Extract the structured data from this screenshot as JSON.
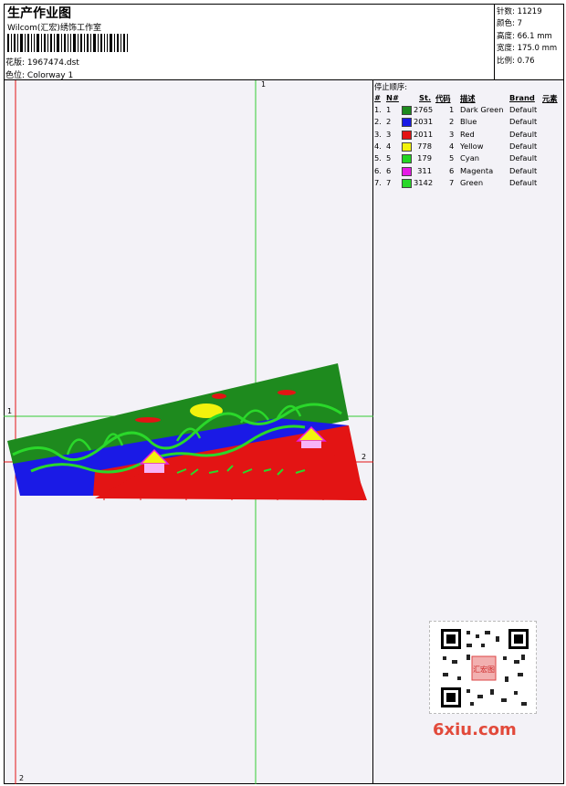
{
  "header": {
    "title": "生产作业图",
    "company": "Wilcom(汇宏)绣饰工作室",
    "design_label": "花版:",
    "design_value": "1967474.dst",
    "colorway_label": "色位:",
    "colorway_value": "Colorway 1"
  },
  "stats": {
    "stitches_label": "针数:",
    "stitches_value": "11219",
    "colors_label": "颜色:",
    "colors_value": "7",
    "height_label": "高度:",
    "height_value": "66.1 mm",
    "width_label": "宽度:",
    "width_value": "175.0 mm",
    "scale_label": "比例:",
    "scale_value": "0.76"
  },
  "stop_sequence": {
    "title": "停止顺序:",
    "columns": [
      "#",
      "N#",
      "St.",
      "代码",
      "描述",
      "Brand",
      "元素"
    ],
    "rows": [
      {
        "idx": "1.",
        "n": "1",
        "color": "#1e8a1e",
        "st": "2765",
        "code": "1",
        "desc": "Dark Green",
        "brand": "Default"
      },
      {
        "idx": "2.",
        "n": "2",
        "color": "#1a1ae6",
        "st": "2031",
        "code": "2",
        "desc": "Blue",
        "brand": "Default"
      },
      {
        "idx": "3.",
        "n": "3",
        "color": "#e31414",
        "st": "2011",
        "code": "3",
        "desc": "Red",
        "brand": "Default"
      },
      {
        "idx": "4.",
        "n": "4",
        "color": "#f2f20d",
        "st": "778",
        "code": "4",
        "desc": "Yellow",
        "brand": "Default"
      },
      {
        "idx": "5.",
        "n": "5",
        "color": "#22d622",
        "st": "179",
        "code": "5",
        "desc": "Cyan",
        "brand": "Default"
      },
      {
        "idx": "6.",
        "n": "6",
        "color": "#e61ae6",
        "st": "311",
        "code": "6",
        "desc": "Magenta",
        "brand": "Default"
      },
      {
        "idx": "7.",
        "n": "7",
        "color": "#2ad82a",
        "st": "3142",
        "code": "7",
        "desc": "Green",
        "brand": "Default"
      }
    ]
  },
  "canvas": {
    "axis_labels": {
      "top": "1",
      "left": "1",
      "right": "2",
      "bottom": "2"
    }
  },
  "watermark": {
    "text": "6xiu.com",
    "qr_caption": "汇宏图"
  }
}
